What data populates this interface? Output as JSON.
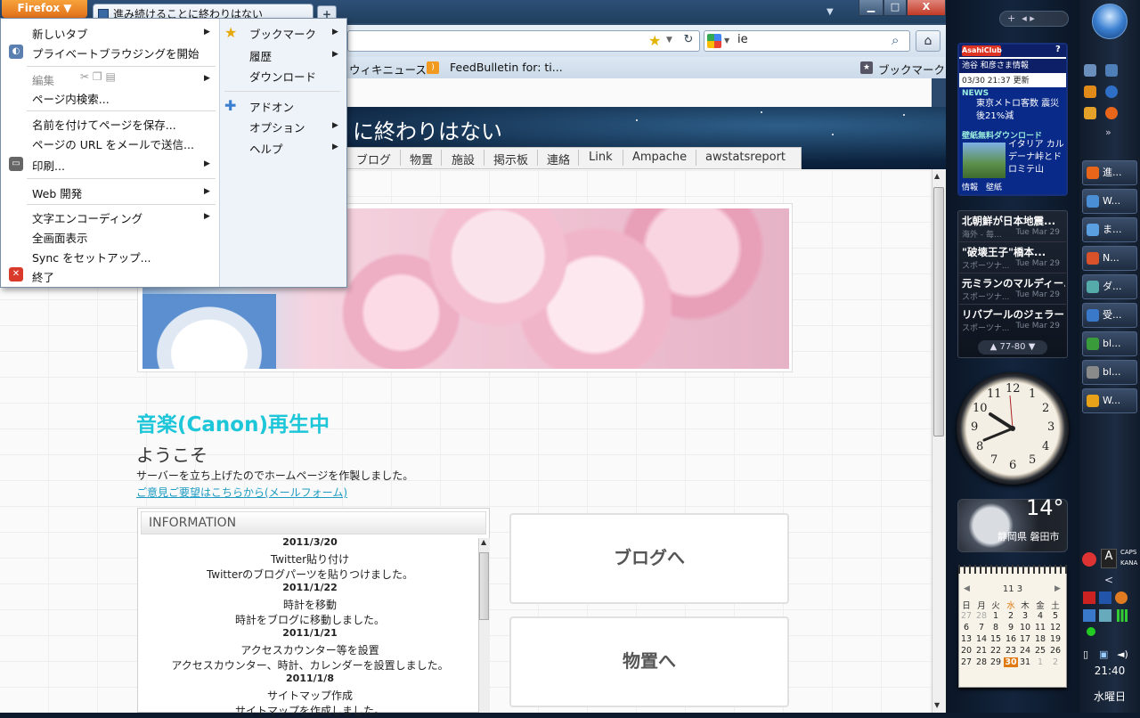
{
  "browser": {
    "app_button": "Firefox ▼",
    "tab_title": "進み続けることに終わりはない",
    "new_tab": "+",
    "search_value": "ie",
    "bookmark_items": [
      "ウィキニュース",
      "FeedBulletin for: ti..."
    ],
    "bookmarks_menu_label": "ブックマーク",
    "window_controls": {
      "min": "▁",
      "max": "□",
      "close": "X"
    }
  },
  "app_menu": {
    "left": [
      {
        "label": "新しいタブ",
        "arrow": true,
        "disabled": false
      },
      {
        "label": "プライベートブラウジングを開始",
        "arrow": false,
        "disabled": false
      },
      {
        "label": "編集",
        "arrow": true,
        "disabled": true
      },
      {
        "label": "ページ内検索...",
        "arrow": false,
        "disabled": false
      },
      {
        "label": "名前を付けてページを保存...",
        "arrow": false,
        "disabled": false
      },
      {
        "label": "ページの URL をメールで送信...",
        "arrow": false,
        "disabled": false
      },
      {
        "label": "印刷...",
        "arrow": true,
        "disabled": false
      },
      {
        "label": "Web 開発",
        "arrow": true,
        "disabled": false
      },
      {
        "label": "文字エンコーディング",
        "arrow": true,
        "disabled": false
      },
      {
        "label": "全画面表示",
        "arrow": false,
        "disabled": false
      },
      {
        "label": "Sync をセットアップ...",
        "arrow": false,
        "disabled": false
      },
      {
        "label": "終了",
        "arrow": false,
        "disabled": false
      }
    ],
    "right": [
      {
        "label": "ブックマーク",
        "arrow": true
      },
      {
        "label": "履歴",
        "arrow": true
      },
      {
        "label": "ダウンロード",
        "arrow": false
      },
      {
        "label": "アドオン",
        "arrow": false
      },
      {
        "label": "オプション",
        "arrow": true
      },
      {
        "label": "ヘルプ",
        "arrow": true
      }
    ]
  },
  "site": {
    "title": "に終わりはない",
    "nav": [
      "ブログ",
      "物置",
      "施設",
      "掲示板",
      "連絡",
      "Link",
      "Ampache",
      "awstatsreport"
    ],
    "music_heading": "音楽(Canon)再生中",
    "welcome": "ようこそ",
    "intro": "サーバーを立ち上げたのでホームページを作製しました。",
    "form_link": "ご意見ご要望はこちらから(メールフォーム)",
    "info_heading": "INFORMATION",
    "info_lines": [
      {
        "text": "2011/3/20",
        "date": true
      },
      {
        "text": "Twitter貼り付け",
        "date": false
      },
      {
        "text": "Twitterのブログパーツを貼りつけました。",
        "date": false
      },
      {
        "text": "2011/1/22",
        "date": true
      },
      {
        "text": "時計を移動",
        "date": false
      },
      {
        "text": "時計をブログに移動しました。",
        "date": false
      },
      {
        "text": "2011/1/21",
        "date": true
      },
      {
        "text": "アクセスカウンター等を設置",
        "date": false
      },
      {
        "text": "アクセスカウンター、時計、カレンダーを設置しました。",
        "date": false
      },
      {
        "text": "2011/1/8",
        "date": true
      },
      {
        "text": "サイトマップ作成",
        "date": false
      },
      {
        "text": "サイトマップを作成しました。",
        "date": false
      }
    ],
    "buttons": [
      "ブログへ",
      "物置へ"
    ]
  },
  "gadgets": {
    "news": {
      "brand": "AsahiClub",
      "user": "池谷 和彦さま情報",
      "date": "03/30 21:37 更新",
      "news_label": "NEWS",
      "news_text": "東京メトロ客数 震災後21%減",
      "wallpaper_label": "壁紙無料ダウンロード",
      "wallpaper_text": "イタリア カルデーナ峠とドロミテ山",
      "footer": "情報　壁紙"
    },
    "feeds": [
      {
        "title": "北朝鮮が日本地震...",
        "src": "海外 - 毎...",
        "date": "Tue Mar 29"
      },
      {
        "title": "\"破壊王子\"橋本...",
        "src": "スポーツナ...",
        "date": "Tue Mar 29"
      },
      {
        "title": "元ミランのマルディー...",
        "src": "スポーツナ...",
        "date": "Tue Mar 29"
      },
      {
        "title": "リバプールのジェラー...",
        "src": "スポーツナ...",
        "date": "Tue Mar 29"
      }
    ],
    "feed_nav": "77-80",
    "clock_numbers": [
      "12",
      "1",
      "2",
      "3",
      "4",
      "5",
      "6",
      "7",
      "8",
      "9",
      "10",
      "11"
    ],
    "weather": {
      "temp": "14°",
      "city": "静岡県 磐田市"
    },
    "calendar": {
      "month": "11 3",
      "weekdays": [
        "日",
        "月",
        "火",
        "水",
        "木",
        "金",
        "土"
      ],
      "rows": [
        [
          "27",
          "28",
          "1",
          "2",
          "3",
          "4",
          "5"
        ],
        [
          "6",
          "7",
          "8",
          "9",
          "10",
          "11",
          "12"
        ],
        [
          "13",
          "14",
          "15",
          "16",
          "17",
          "18",
          "19"
        ],
        [
          "20",
          "21",
          "22",
          "23",
          "24",
          "25",
          "26"
        ],
        [
          "27",
          "28",
          "29",
          "30",
          "31",
          "1",
          "2"
        ]
      ],
      "today": "30"
    }
  },
  "taskbar": {
    "buttons": [
      "進...",
      "W...",
      "ま...",
      "N...",
      "ダ...",
      "受...",
      "bl...",
      "bl...",
      "W..."
    ],
    "time": "21:40",
    "day": "水曜日",
    "caps": "CAPS",
    "kana": "KANA"
  }
}
